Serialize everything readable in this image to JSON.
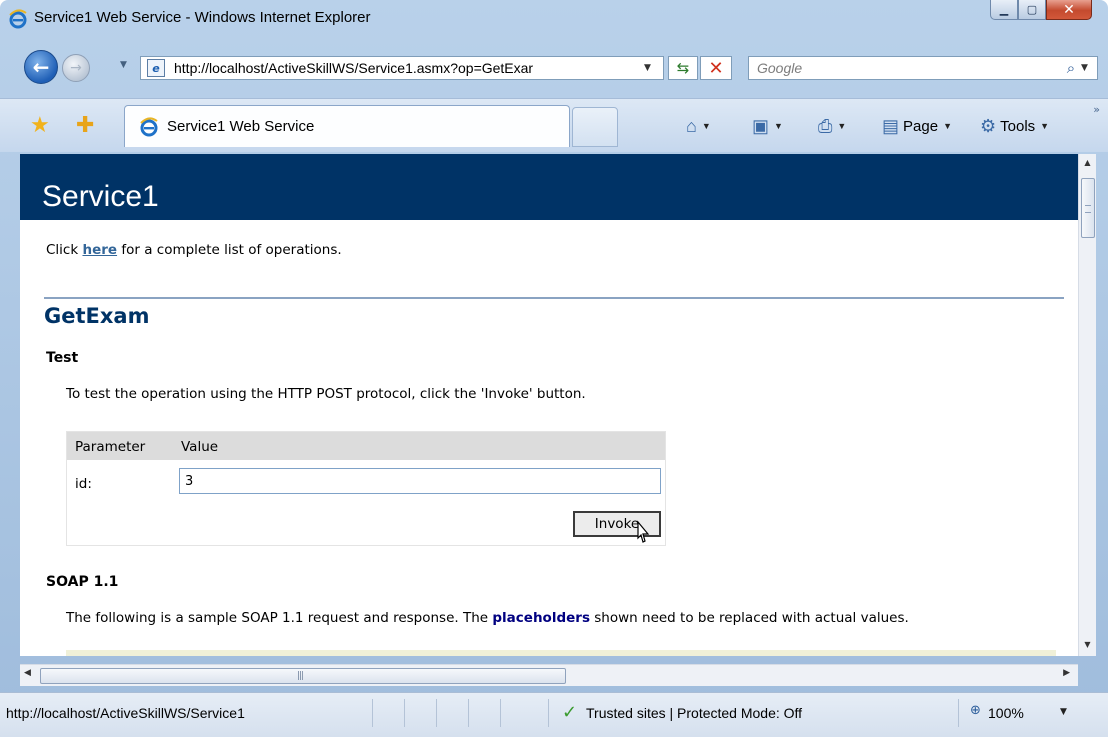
{
  "window": {
    "title": "Service1 Web Service - Windows Internet Explorer"
  },
  "nav": {
    "url": "http://localhost/ActiveSkillWS/Service1.asmx?op=GetExar",
    "search_placeholder": "Google"
  },
  "tabs": {
    "active_label": "Service1 Web Service"
  },
  "commands": {
    "page": "Page",
    "tools": "Tools"
  },
  "page": {
    "banner_title": "Service1",
    "intro_prefix": "Click ",
    "intro_link": "here",
    "intro_suffix": " for a complete list of operations.",
    "operation": "GetExam",
    "test_heading": "Test",
    "test_text": "To test the operation using the HTTP POST protocol, click the 'Invoke' button.",
    "table": {
      "col_parameter": "Parameter",
      "col_value": "Value",
      "param_label": "id:",
      "param_value": "3",
      "invoke_label": "Invoke"
    },
    "soap_heading": "SOAP 1.1",
    "soap_text_1": "The following is a sample SOAP 1.1 request and response. The ",
    "soap_keyword": "placeholders",
    "soap_text_2": " shown need to be replaced with actual values."
  },
  "status": {
    "url": "http://localhost/ActiveSkillWS/Service1",
    "zone": "Trusted sites | Protected Mode: Off",
    "zoom": "100%"
  },
  "colors": {
    "banner": "#003366",
    "link": "#336699",
    "keyword": "#000080"
  },
  "icons": [
    "ie-icon",
    "back-arrow-icon",
    "forward-arrow-icon",
    "page-icon",
    "refresh-icon",
    "stop-icon",
    "search-icon",
    "favorites-star-icon",
    "add-favorites-icon",
    "home-icon",
    "feeds-icon",
    "print-icon",
    "page-menu-icon",
    "tools-gear-icon",
    "checkmark-icon",
    "zoom-icon"
  ]
}
